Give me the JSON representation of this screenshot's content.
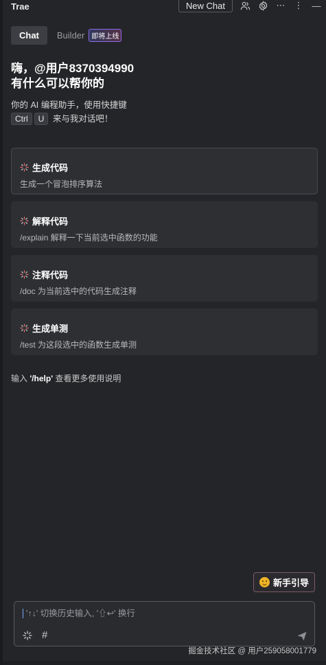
{
  "app": {
    "title": "Trae"
  },
  "header": {
    "new_chat_label": "New Chat"
  },
  "tabs": [
    {
      "label": "Chat",
      "active": true
    },
    {
      "label": "Builder",
      "active": false,
      "badge": "即将上线"
    }
  ],
  "greeting": {
    "line1": "嗨，@用户8370394990",
    "line2": "有什么可以帮你的",
    "intro": "你的 AI 编程助手，使用快捷键",
    "key1": "Ctrl",
    "key2": "U",
    "intro_tail": "来与我对话吧！"
  },
  "cards": [
    {
      "title": "生成代码",
      "desc": "生成一个冒泡排序算法"
    },
    {
      "title": "解释代码",
      "desc": "/explain 解释一下当前选中函数的功能"
    },
    {
      "title": "注释代码",
      "desc": "/doc 为当前选中的代码生成注释"
    },
    {
      "title": "生成单测",
      "desc": "/test 为这段选中的函数生成单测"
    }
  ],
  "help": {
    "prefix": "输入",
    "command": "'/help'",
    "suffix": "查看更多使用说明"
  },
  "guide_button": {
    "label": "新手引导"
  },
  "input": {
    "placeholder": "'↑↓' 切换历史输入, '⇧↩' 换行"
  },
  "watermark": "掘金技术社区 @ 用户2590580017​79",
  "colors": {
    "accent_badge_border": "#8f6be8",
    "guide_border": "#7b5d62"
  }
}
